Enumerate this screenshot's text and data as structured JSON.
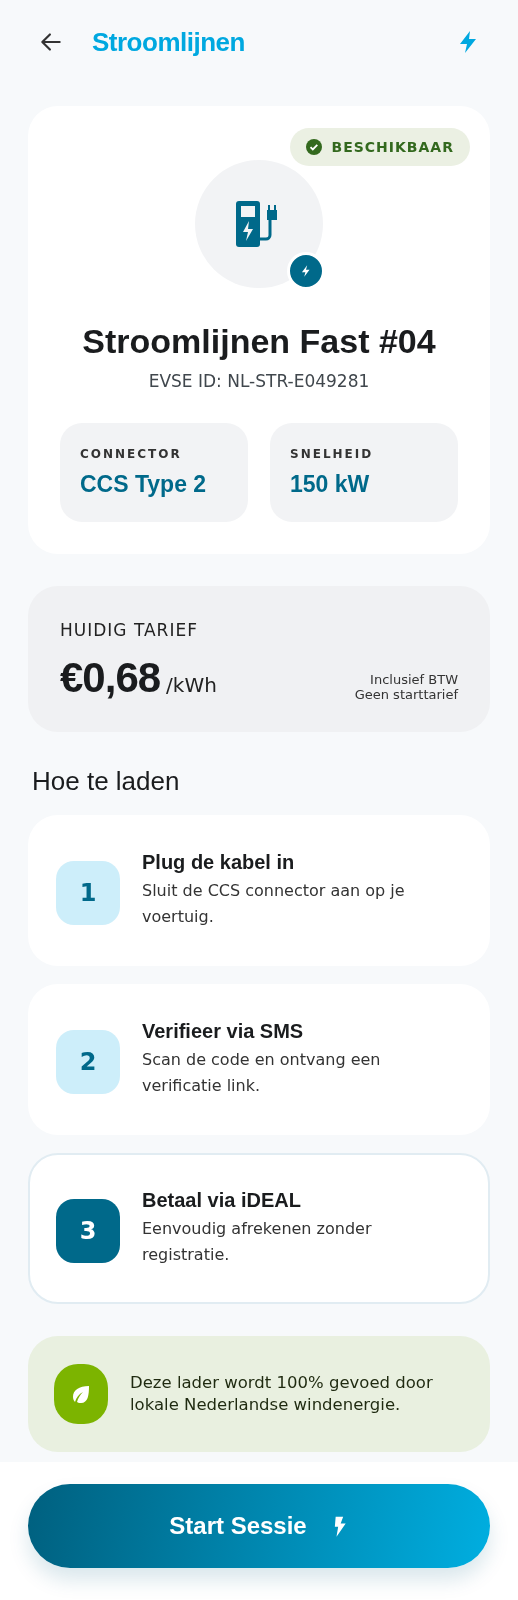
{
  "header": {
    "title": "Stroomlijnen"
  },
  "charger": {
    "status": "BESCHIKBAAR",
    "available": true,
    "name": "Stroomlijnen Fast #04",
    "evse_id": "EVSE ID: NL-STR-E049281",
    "specs": [
      {
        "label": "CONNECTOR",
        "value": "CCS Type 2"
      },
      {
        "label": "SNELHEID",
        "value": "150 kW"
      }
    ]
  },
  "tariff": {
    "label": "HUIDIG TARIEF",
    "price": "€0,68",
    "unit": "/kWh",
    "notes": [
      "Inclusief BTW",
      "Geen starttarief"
    ]
  },
  "steps_title": "Hoe te laden",
  "steps": [
    {
      "number": "1",
      "title": "Plug de kabel in",
      "text": "Sluit de CCS connector aan op je voertuig.",
      "selected": false
    },
    {
      "number": "2",
      "title": "Verifieer via SMS",
      "text": "Scan de code en ontvang een verificatie link.",
      "selected": false
    },
    {
      "number": "3",
      "title": "Betaal via iDEAL",
      "text": "Eenvoudig afrekenen zonder registratie.",
      "selected": true
    }
  ],
  "eco_note": "Deze lader wordt 100% gevoed door lokale Nederlandse windenergie.",
  "start_button": "Start Sessie"
}
